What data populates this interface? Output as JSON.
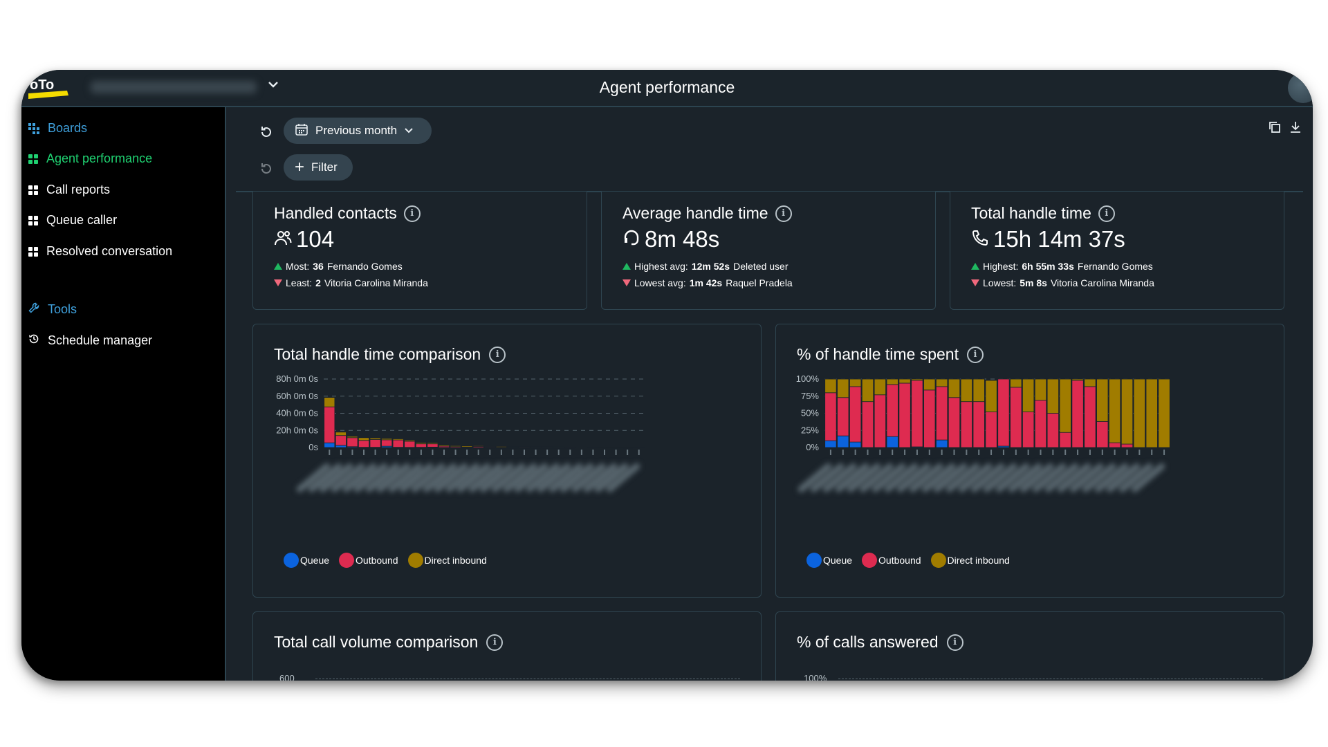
{
  "header": {
    "title": "Agent performance",
    "logo_text": "GoTo",
    "account_name": "CBX EXECUTIVE NEGOC..."
  },
  "sidebar": {
    "boards_label": "Boards",
    "items": [
      {
        "label": "Agent performance",
        "active": true
      },
      {
        "label": "Call reports",
        "active": false
      },
      {
        "label": "Queue caller",
        "active": false
      },
      {
        "label": "Resolved conversation",
        "active": false
      }
    ],
    "tools_label": "Tools",
    "tools_items": [
      {
        "label": "Schedule manager"
      }
    ]
  },
  "toolbar": {
    "date_range": "Previous month",
    "filter_label": "Filter"
  },
  "kpis": [
    {
      "title": "Handled contacts",
      "icon": "people-icon",
      "value": "104",
      "high_label": "Most:",
      "high_value": "36",
      "high_name": "Fernando Gomes",
      "low_label": "Least:",
      "low_value": "2",
      "low_name": "Vitoria Carolina Miranda"
    },
    {
      "title": "Average handle time",
      "icon": "headset-icon",
      "value": "8m 48s",
      "high_label": "Highest avg:",
      "high_value": "12m 52s",
      "high_name": "Deleted user",
      "low_label": "Lowest avg:",
      "low_value": "1m 42s",
      "low_name": "Raquel Pradela"
    },
    {
      "title": "Total handle time",
      "icon": "phone-icon",
      "value": "15h 14m 37s",
      "high_label": "Highest:",
      "high_value": "6h 55m 33s",
      "high_name": "Fernando Gomes",
      "low_label": "Lowest:",
      "low_value": "5m 8s",
      "low_name": "Vitoria Carolina Miranda"
    }
  ],
  "colors": {
    "queue": "#0b63de",
    "outbound": "#de2b50",
    "direct_inbound": "#a07c00",
    "accent_green": "#1fd171",
    "accent_blue": "#3fa0dc"
  },
  "chart_data": [
    {
      "type": "bar",
      "stacked": true,
      "title": "Total handle time comparison",
      "xlabel": "",
      "ylabel": "",
      "ylim": [
        0,
        80
      ],
      "y_unit": "hours",
      "yticks": [
        "0s",
        "20h 0m 0s",
        "40h 0m 0s",
        "60h 0m 0s",
        "80h 0m 0s"
      ],
      "yticks_values": [
        0,
        20,
        40,
        60,
        80
      ],
      "grid": true,
      "legend_position": "bottom-left",
      "categories_blurred": true,
      "categories": [
        "A1",
        "A2",
        "A3",
        "A4",
        "A5",
        "A6",
        "A7",
        "A8",
        "A9",
        "A10",
        "A11",
        "A12",
        "A13",
        "A14",
        "A15",
        "A16",
        "A17",
        "A18",
        "A19",
        "A20",
        "A21",
        "A22",
        "A23",
        "A24",
        "A25",
        "A26",
        "A27",
        "A28"
      ],
      "series": [
        {
          "name": "Queue",
          "values": [
            5.5,
            2.5,
            1,
            0.3,
            0.3,
            1.5,
            0.3,
            0.2,
            0.3,
            0.5,
            0.1,
            0.1,
            0.05,
            0.05,
            0.05,
            0.02,
            0.02,
            0.02,
            0.01,
            0.01,
            0.01,
            0.01,
            0,
            0,
            0,
            0,
            0,
            0
          ]
        },
        {
          "name": "Outbound",
          "values": [
            42,
            11.5,
            10.5,
            8,
            9,
            7.5,
            8.5,
            7,
            4,
            3.8,
            1.5,
            1,
            0.5,
            1.2,
            0.8,
            0.3,
            0.5,
            0.8,
            0.6,
            0.5,
            0.4,
            0.2,
            0.3,
            0.3,
            0.2,
            0.15,
            0.1,
            0
          ]
        },
        {
          "name": "Direct inbound",
          "values": [
            11,
            4,
            1.5,
            3.2,
            1.8,
            1.5,
            1.3,
            1.3,
            1.3,
            1.2,
            1.2,
            1,
            1.2,
            0.8,
            0.4,
            0.9,
            0.6,
            0.3,
            0.2,
            0.2,
            0.2,
            0.2,
            0.15,
            0.1,
            0.1,
            0.1,
            0.08,
            0.3
          ]
        }
      ]
    },
    {
      "type": "bar",
      "stacked": true,
      "percent": true,
      "title": "% of handle time spent",
      "xlabel": "",
      "ylabel": "",
      "ylim": [
        0,
        100
      ],
      "yticks": [
        "0%",
        "25%",
        "50%",
        "75%",
        "100%"
      ],
      "yticks_values": [
        0,
        25,
        50,
        75,
        100
      ],
      "grid": true,
      "legend_position": "bottom-left",
      "categories_blurred": true,
      "categories": [
        "A1",
        "A2",
        "A3",
        "A4",
        "A5",
        "A6",
        "A7",
        "A8",
        "A9",
        "A10",
        "A11",
        "A12",
        "A13",
        "A14",
        "A15",
        "A16",
        "A17",
        "A18",
        "A19",
        "A20",
        "A21",
        "A22",
        "A23",
        "A24",
        "A25",
        "A26",
        "A27",
        "A28"
      ],
      "series": [
        {
          "name": "Queue",
          "values": [
            10,
            17,
            8,
            0,
            0,
            16,
            0,
            1,
            0,
            11,
            0,
            0,
            0,
            0,
            2,
            0,
            0,
            0,
            0,
            0,
            0,
            0,
            0,
            0,
            0,
            0,
            0,
            0
          ]
        },
        {
          "name": "Outbound",
          "values": [
            70,
            56,
            81,
            67,
            77,
            76,
            94,
            97,
            84,
            78,
            73,
            67,
            67,
            52,
            98,
            88,
            52,
            69,
            50,
            22,
            98,
            89,
            38,
            7,
            5,
            0,
            0,
            0
          ]
        },
        {
          "name": "Direct inbound",
          "values": [
            20,
            27,
            11,
            33,
            23,
            8,
            6,
            2,
            16,
            11,
            27,
            33,
            33,
            46,
            0,
            12,
            48,
            31,
            50,
            78,
            2,
            11,
            62,
            93,
            95,
            100,
            100,
            100
          ]
        }
      ]
    }
  ],
  "lower_cards": [
    {
      "title": "Total call volume comparison",
      "first_tick": "600"
    },
    {
      "title": "% of calls answered",
      "first_tick": "100%"
    }
  ]
}
